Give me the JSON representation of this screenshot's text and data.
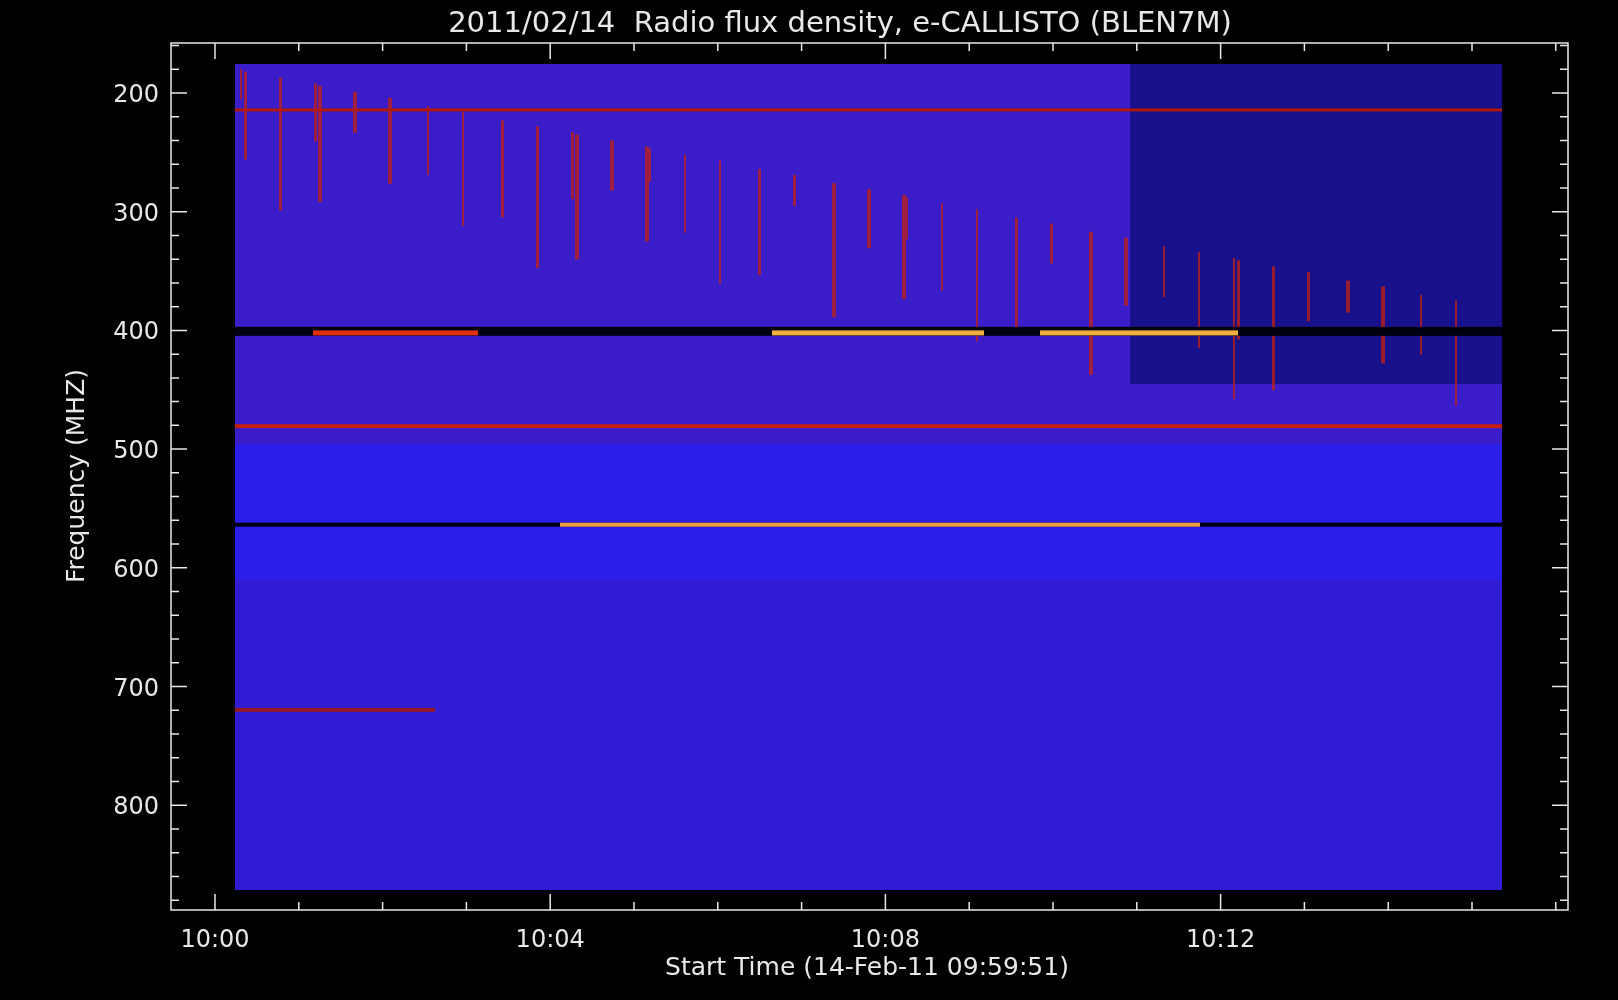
{
  "plot": {
    "title": "2011/02/14  Radio flux density, e-CALLISTO (BLEN7M)",
    "xlabel": "Start Time (14-Feb-11 09:59:51)",
    "ylabel": "Frequency (MHZ)",
    "xticks": [
      "10:00",
      "10:04",
      "10:08",
      "10:12"
    ],
    "yticks": [
      "200",
      "300",
      "400",
      "500",
      "600",
      "700",
      "800"
    ]
  }
}
